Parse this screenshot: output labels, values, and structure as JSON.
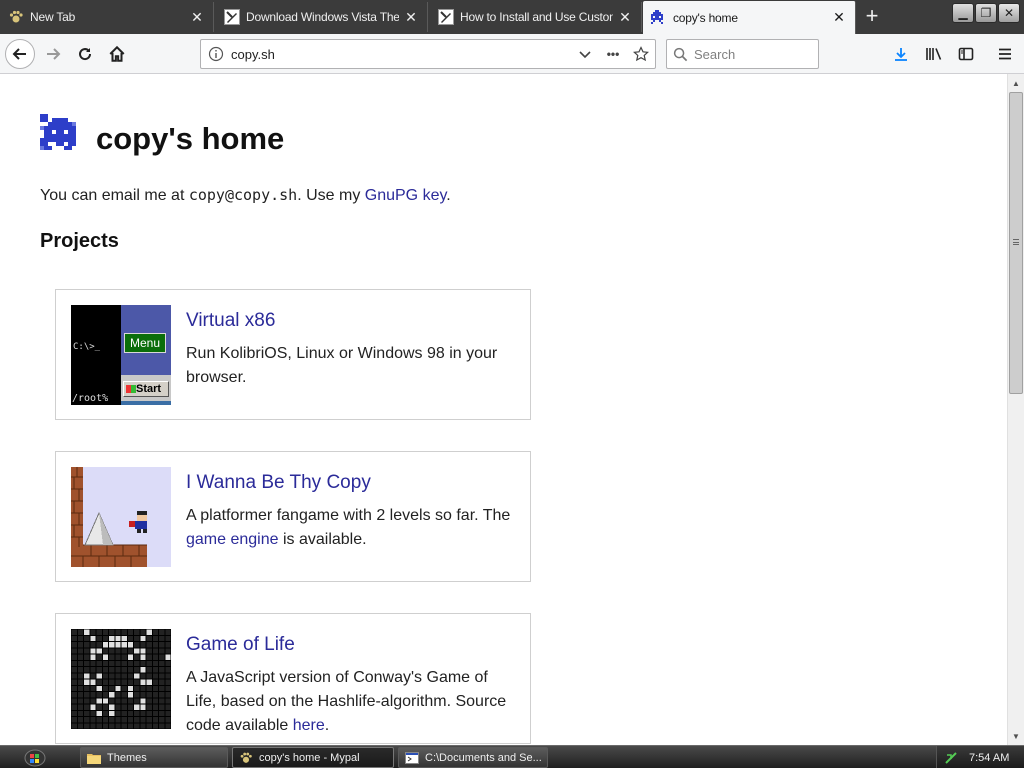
{
  "browser": {
    "tabs": [
      {
        "title": "New Tab",
        "icon": "pawprint-icon",
        "active": false
      },
      {
        "title": "Download Windows Vista Theme",
        "icon": "pen-icon",
        "active": false
      },
      {
        "title": "How to Install and Use Custom",
        "icon": "pen-icon",
        "active": false
      },
      {
        "title": "copy's home",
        "icon": "invader-icon",
        "active": true
      }
    ],
    "new_tab_symbol": "+",
    "close_symbol": "✕",
    "window_buttons": {
      "minimize": "▁",
      "restore": "❐",
      "close": "✕"
    },
    "url": "copy.sh",
    "search_placeholder": "Search",
    "page_actions": "•••",
    "accent_color": "#0a84ff"
  },
  "page": {
    "title": "copy's home",
    "intro_text": "You can email me at ",
    "email": "copy@copy.sh",
    "intro_mid": ". Use my ",
    "gpg_link": "GnuPG key",
    "intro_end": ".",
    "projects_heading": "Projects",
    "link_color": "#2b2b99",
    "projects": [
      {
        "title": "Virtual x86",
        "description": "Run KolibriOS, Linux or Windows 98 in your browser.",
        "thumb": {
          "prompt": "C:\\>_",
          "menu_label": "Menu",
          "start_label": "Start",
          "root_label": "/root%"
        }
      },
      {
        "title": "I Wanna Be Thy Copy",
        "description_pre": "A platformer fangame with 2 levels so far. The ",
        "description_link": "game engine",
        "description_post": " is available."
      },
      {
        "title": "Game of Life",
        "description_pre": "A JavaScript version of Conway's Game of Life, based on the Hashlife-algorithm. Source code available ",
        "description_link": "here",
        "description_post": "."
      }
    ]
  },
  "taskbar": {
    "items": [
      {
        "label": "Themes",
        "icon": "folder-icon",
        "active": false
      },
      {
        "label": "copy's home - Mypal",
        "icon": "pawprint-icon",
        "active": true
      },
      {
        "label": "C:\\Documents and Se...",
        "icon": "console-icon",
        "active": false
      }
    ],
    "clock": "7:54 AM"
  }
}
